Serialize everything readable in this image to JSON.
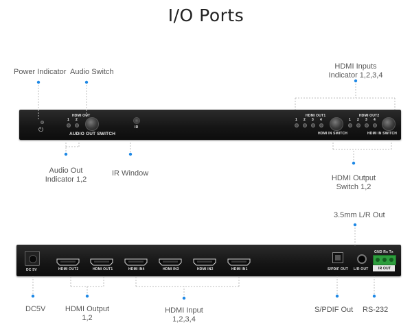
{
  "title": "I/O Ports",
  "front_callouts": {
    "power_indicator": "Power Indicator",
    "audio_switch": "Audio Switch",
    "hdmi_inputs_indicator": "HDMI Inputs\nIndicator 1,2,3,4",
    "audio_out_indicator": "Audio Out\nIndicator 1,2",
    "ir_window": "IR Window",
    "hdmi_output_switch": "HDMI Output\nSwitch 1,2"
  },
  "front_panel": {
    "hdmi_out_label": "HDMI OUT",
    "audio_led_numbers": [
      "1",
      "2"
    ],
    "audio_out_switch_label": "AUDIO OUT SWITCH",
    "ir_label": "IR",
    "hdmi_out1_label": "HDMI OUT1",
    "hdmi_out2_label": "HDMI OUT2",
    "hdmi_led_numbers": [
      "1",
      "2",
      "3",
      "4"
    ],
    "hdmi_in_switch_label": "HDMI IN SWITCH"
  },
  "rear_callouts": {
    "lr_out_35": "3.5mm L/R Out",
    "dc5v": "DC5V",
    "hdmi_output": "HDMI Output\n1,2",
    "hdmi_input": "HDMI Input\n1,2,3,4",
    "spdif_out": "S/PDIF Out",
    "rs232": "RS-232"
  },
  "rear_panel": {
    "dc_label": "DC 5V",
    "hdmi_out2": "HDMI OUT2",
    "hdmi_out1": "HDMI OUT1",
    "hdmi_in4": "HDMI IN4",
    "hdmi_in3": "HDMI IN3",
    "hdmi_in2": "HDMI IN2",
    "hdmi_in1": "HDMI IN1",
    "spdif_label": "S/PDIF OUT",
    "lr_label": "L/R OUT",
    "rs232_pins": "GND  Rx  Tx",
    "ir_out_label": "IR OUT"
  },
  "colors": {
    "dot": "#1e88e5",
    "leader": "#bdbdbd",
    "panel": "#1a1a1a"
  }
}
